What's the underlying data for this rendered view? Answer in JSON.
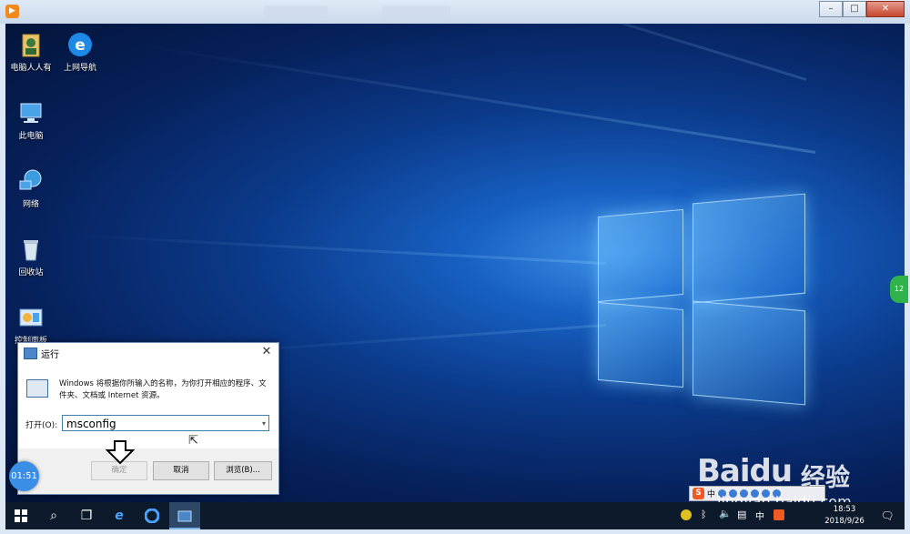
{
  "outer_window": {
    "buttons": [
      "–",
      "□",
      "✕"
    ]
  },
  "desktop_icons": [
    {
      "label": "电脑人人有",
      "icon": "user-folder-icon"
    },
    {
      "label": "上网导航",
      "icon": "ie-icon"
    },
    {
      "label": "此电脑",
      "icon": "computer-icon"
    },
    {
      "label": "网络",
      "icon": "network-icon"
    },
    {
      "label": "回收站",
      "icon": "recycle-bin-icon"
    },
    {
      "label": "控制面板",
      "icon": "control-panel-icon"
    }
  ],
  "run_dialog": {
    "title": "运行",
    "description": "Windows 将根据你所输入的名称，为你打开相应的程序、文件夹、文档或 Internet 资源。",
    "open_label": "打开(O):",
    "input_value": "msconfig",
    "ok_button": "确定",
    "cancel_button": "取消",
    "browse_button": "浏览(B)..."
  },
  "timer": "01:51",
  "side_badge": "12",
  "taskbar": {
    "clock_time": "18:53",
    "clock_date": "2018/9/26",
    "tray_icons": [
      "shield-icon",
      "bluetooth-icon",
      "volume-icon",
      "network-icon",
      "ime-icon",
      "sogou-icon"
    ],
    "ime_mode": "中"
  },
  "watermark": {
    "brand": "Baidu",
    "brand_suffix": "经验",
    "url": "jingyan.baidu.com",
    "ime_text": "中"
  }
}
